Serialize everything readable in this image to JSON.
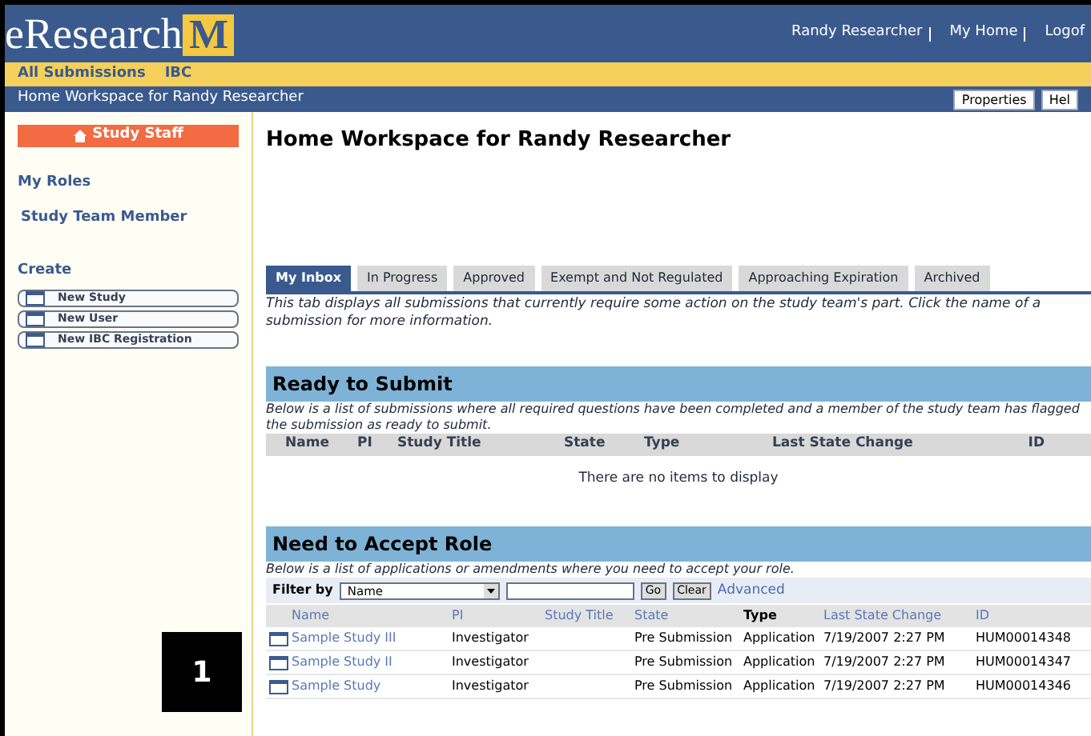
{
  "header": {
    "logo_text": "eResearch",
    "logo_mark": "M",
    "user_links": [
      "Randy Researcher",
      "My Home",
      "Logof"
    ]
  },
  "nav": {
    "items": [
      "All Submissions",
      "IBC"
    ]
  },
  "breadcrumb": {
    "title": "Home Workspace for Randy Researcher",
    "buttons": [
      "Properties",
      "Hel"
    ]
  },
  "sidebar": {
    "staff_button": "Study Staff",
    "roles_heading": "My Roles",
    "roles": [
      "Study Team Member"
    ],
    "create_heading": "Create",
    "create_items": [
      "New Study",
      "New User",
      "New IBC Registration"
    ]
  },
  "page_title": "Home Workspace for Randy Researcher",
  "tabs": [
    {
      "label": "My Inbox",
      "selected": true
    },
    {
      "label": "In Progress",
      "selected": false
    },
    {
      "label": "Approved",
      "selected": false
    },
    {
      "label": "Exempt and Not Regulated",
      "selected": false
    },
    {
      "label": "Approaching Expiration",
      "selected": false
    },
    {
      "label": "Archived",
      "selected": false
    }
  ],
  "tab_description": "This tab displays all submissions that currently require some action on the study team's part. Click the name of a submission for more information.",
  "ready_to_submit": {
    "title": "Ready to Submit",
    "description": "Below is a list of submissions where all required questions have been completed and a member of the study team has flagged the submission as ready to submit.",
    "columns": [
      "Name",
      "PI",
      "Study Title",
      "State",
      "Type",
      "Last State Change",
      "ID"
    ],
    "empty_message": "There are no items to display"
  },
  "need_to_accept_role": {
    "title": "Need to Accept Role",
    "description": "Below is a list of applications or amendments where you need to accept your role.",
    "filter": {
      "label": "Filter by",
      "field": "Name",
      "go": "Go",
      "clear": "Clear",
      "advanced": "Advanced"
    },
    "columns": [
      {
        "label": "Name",
        "sortable": true
      },
      {
        "label": "PI",
        "sortable": true
      },
      {
        "label": "Study Title",
        "sortable": true
      },
      {
        "label": "State",
        "sortable": true
      },
      {
        "label": "Type",
        "sortable": false
      },
      {
        "label": "Last State Change",
        "sortable": true
      },
      {
        "label": "ID",
        "sortable": true
      }
    ],
    "rows": [
      [
        "Sample Study III",
        "Investigator",
        "",
        "Pre Submission",
        "Application",
        "7/19/2007 2:27 PM",
        "HUM00014348"
      ],
      [
        "Sample Study II",
        "Investigator",
        "",
        "Pre Submission",
        "Application",
        "7/19/2007 2:27 PM",
        "HUM00014347"
      ],
      [
        "Sample Study",
        "Investigator",
        "",
        "Pre Submission",
        "Application",
        "7/19/2007 2:27 PM",
        "HUM00014346"
      ]
    ]
  },
  "callout": "1"
}
